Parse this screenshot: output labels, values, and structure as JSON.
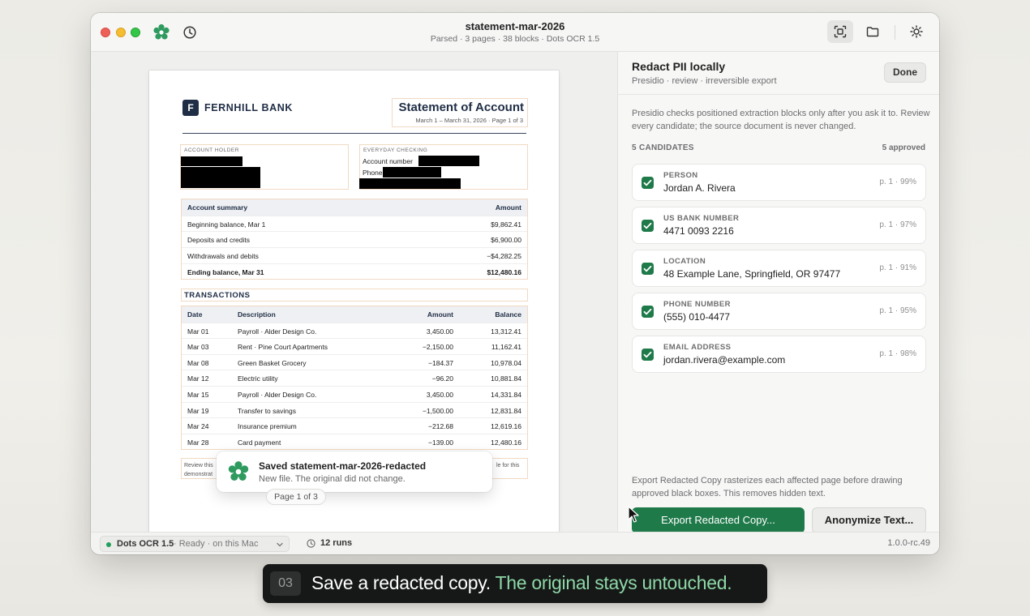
{
  "window": {
    "title": "statement-mar-2026",
    "subtitle": "Parsed · 3 pages · 38 blocks · Dots OCR 1.5"
  },
  "document": {
    "bank_initial": "F",
    "bank_name": "FERNHILL BANK",
    "statement_title": "Statement of Account",
    "statement_period": "March 1 – March 31, 2026 · Page 1 of 3",
    "account_holder_label": "ACCOUNT HOLDER",
    "checking_label": "EVERYDAY CHECKING",
    "account_number_label": "Account number",
    "phone_label": "Phone",
    "summary": {
      "header_label": "Account summary",
      "header_amount": "Amount",
      "rows": [
        {
          "label": "Beginning balance, Mar 1",
          "amount": "$9,862.41"
        },
        {
          "label": "Deposits and credits",
          "amount": "$6,900.00"
        },
        {
          "label": "Withdrawals and debits",
          "amount": "−$4,282.25"
        },
        {
          "label": "Ending balance, Mar 31",
          "amount": "$12,480.16"
        }
      ]
    },
    "transactions_title": "TRANSACTIONS",
    "transactions": {
      "headers": {
        "date": "Date",
        "description": "Description",
        "amount": "Amount",
        "balance": "Balance"
      },
      "rows": [
        {
          "date": "Mar 01",
          "description": "Payroll · Alder Design Co.",
          "amount": "3,450.00",
          "balance": "13,312.41"
        },
        {
          "date": "Mar 03",
          "description": "Rent · Pine Court Apartments",
          "amount": "−2,150.00",
          "balance": "11,162.41"
        },
        {
          "date": "Mar 08",
          "description": "Green Basket Grocery",
          "amount": "−184.37",
          "balance": "10,978.04"
        },
        {
          "date": "Mar 12",
          "description": "Electric utility",
          "amount": "−96.20",
          "balance": "10,881.84"
        },
        {
          "date": "Mar 15",
          "description": "Payroll · Alder Design Co.",
          "amount": "3,450.00",
          "balance": "14,331.84"
        },
        {
          "date": "Mar 19",
          "description": "Transfer to savings",
          "amount": "−1,500.00",
          "balance": "12,831.84"
        },
        {
          "date": "Mar 24",
          "description": "Insurance premium",
          "amount": "−212.68",
          "balance": "12,619.16"
        },
        {
          "date": "Mar 28",
          "description": "Card payment",
          "amount": "−139.00",
          "balance": "12,480.16"
        }
      ]
    },
    "footer_left_1": "Review this",
    "footer_left_2": "demonstrat",
    "footer_right": "le for this",
    "page_indicator": "Page 1 of 3"
  },
  "toast": {
    "title": "Saved statement-mar-2026-redacted",
    "subtitle": "New file. The original did not change."
  },
  "side": {
    "title": "Redact PII locally",
    "subtitle": "Presidio · review · irreversible export",
    "done_label": "Done",
    "description": "Presidio checks positioned extraction blocks only after you ask it to. Review every candidate; the source document is never changed.",
    "candidates_label": "5 CANDIDATES",
    "approved_label": "5 approved",
    "candidates": [
      {
        "type": "PERSON",
        "value": "Jordan A. Rivera",
        "meta": "p. 1 · 99%"
      },
      {
        "type": "US BANK NUMBER",
        "value": "4471 0093 2216",
        "meta": "p. 1 · 97%"
      },
      {
        "type": "LOCATION",
        "value": "48 Example Lane, Springfield, OR 97477",
        "meta": "p. 1 · 91%"
      },
      {
        "type": "PHONE NUMBER",
        "value": "(555) 010-4477",
        "meta": "p. 1 · 95%"
      },
      {
        "type": "EMAIL ADDRESS",
        "value": "jordan.rivera@example.com",
        "meta": "p. 1 · 98%"
      }
    ],
    "export_note": "Export Redacted Copy rasterizes each affected page before drawing approved black boxes. This removes hidden text.",
    "export_label": "Export Redacted Copy...",
    "anonymize_label": "Anonymize Text..."
  },
  "status": {
    "engine": "Dots OCR 1.5",
    "engine_status": "· Ready · on this Mac",
    "runs": "12 runs",
    "version": "1.0.0-rc.49"
  },
  "caption": {
    "step": "03",
    "text": "Save a redacted copy. ",
    "highlight": "The original stays untouched."
  },
  "colors": {
    "accent_green": "#1f7a4a",
    "caption_highlight": "#8ed8a8",
    "bank_navy": "#1f2d45"
  },
  "icons": [
    "app-logo-icon",
    "history-icon",
    "scan-icon",
    "folder-icon",
    "appearance-icon",
    "checkbox-icon",
    "chevron-down-icon",
    "clock-icon",
    "pointer-cursor-icon"
  ]
}
